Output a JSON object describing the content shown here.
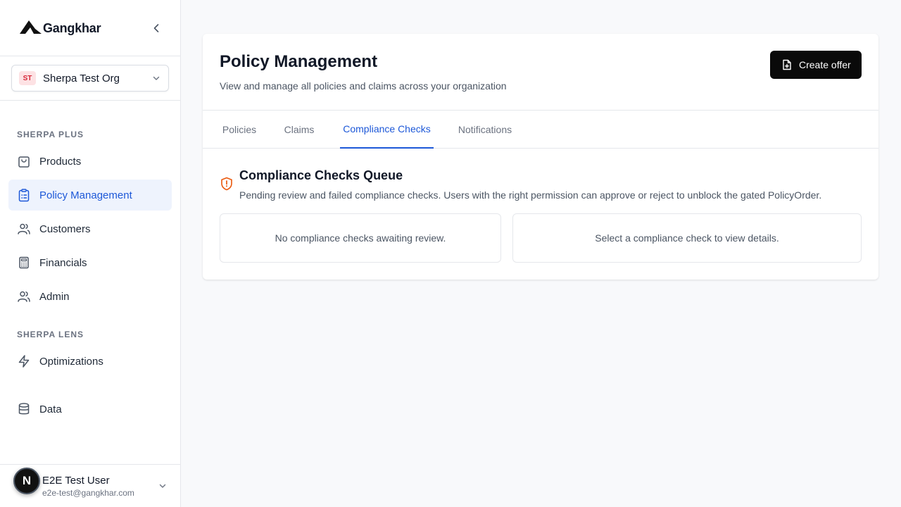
{
  "app": {
    "brand_name": "Gangkhar"
  },
  "org": {
    "initials": "ST",
    "name": "Sherpa Test Org"
  },
  "sidebar": {
    "sections": [
      {
        "label": "SHERPA PLUS"
      },
      {
        "label": "SHERPA LENS"
      }
    ],
    "items": [
      {
        "label": "Products",
        "icon": "shopping-bag-icon"
      },
      {
        "label": "Policy Management",
        "icon": "clipboard-list-icon",
        "active": true
      },
      {
        "label": "Customers",
        "icon": "users-icon"
      },
      {
        "label": "Financials",
        "icon": "calculator-icon"
      },
      {
        "label": "Admin",
        "icon": "users-icon"
      },
      {
        "label": "Optimizations",
        "icon": "lightning-icon"
      },
      {
        "label": "Data",
        "icon": "database-icon"
      }
    ]
  },
  "user": {
    "avatar_letter": "N",
    "name": "E2E Test User",
    "email": "e2e-test@gangkhar.com"
  },
  "header": {
    "title": "Policy Management",
    "subtitle": "View and manage all policies and claims across your organization",
    "create_label": "Create offer"
  },
  "tabs": [
    {
      "label": "Policies"
    },
    {
      "label": "Claims"
    },
    {
      "label": "Compliance Checks",
      "active": true
    },
    {
      "label": "Notifications"
    }
  ],
  "queue": {
    "title": "Compliance Checks Queue",
    "description": "Pending review and failed compliance checks. Users with the right permission can approve or reject to unblock the gated PolicyOrder.",
    "empty_list": "No compliance checks awaiting review.",
    "empty_detail": "Select a compliance check to view details."
  },
  "colors": {
    "accent": "#1d58d8",
    "active_bg": "#eef3fd",
    "warning": "#ea580c",
    "button_bg": "#0a0a0a"
  }
}
